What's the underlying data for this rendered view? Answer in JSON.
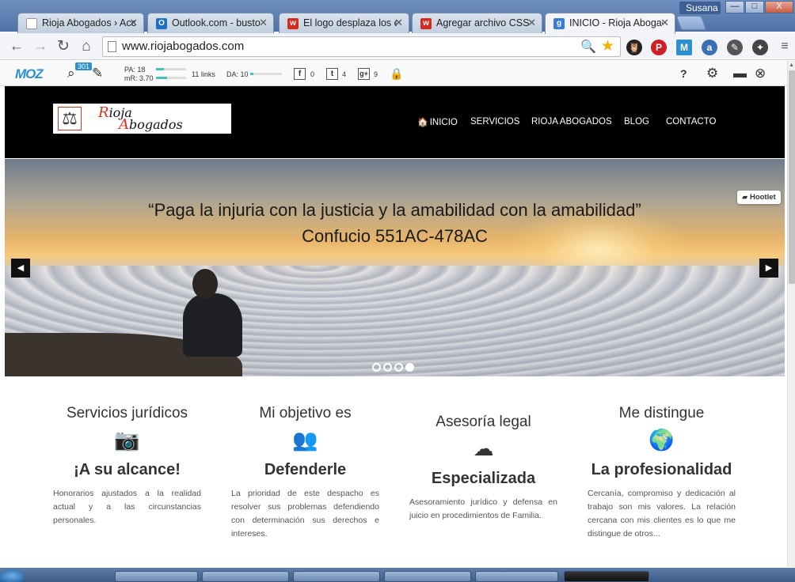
{
  "browser": {
    "tabs": [
      {
        "label": "Rioja Abogados › Acc",
        "favicon": "",
        "active": false
      },
      {
        "label": "Outlook.com - busto",
        "favicon": "O",
        "active": false
      },
      {
        "label": "El logo desplaza los el",
        "favicon": "w",
        "active": false
      },
      {
        "label": "Agregar archivo CSS |",
        "favicon": "w",
        "active": false
      },
      {
        "label": "INICIO - Rioja Abogad",
        "favicon": "g",
        "active": true
      }
    ],
    "profile": "Susana",
    "window_controls": {
      "minimize": "—",
      "maximize": "□",
      "close": "X"
    },
    "url": "www.riojabogados.com"
  },
  "mozbar": {
    "logo": "MOZ",
    "redirect_badge": "301",
    "pa": "PA: 18",
    "mr": "mR: 3.70",
    "links": "11 links",
    "da": "DA: 10",
    "facebook_count": "0",
    "twitter_count": "4",
    "gplus_count": "9",
    "help": "?"
  },
  "site": {
    "logo": {
      "line1_initial": "R",
      "line1_rest": "ioja",
      "line2_initial": "A",
      "line2_rest": "bogados"
    },
    "nav": [
      {
        "label": "INICIO"
      },
      {
        "label": "SERVICIOS"
      },
      {
        "label": "RIOJA ABOGADOS"
      },
      {
        "label": "BLOG"
      },
      {
        "label": "CONTACTO"
      }
    ],
    "hero": {
      "quote": "“Paga la injuria con la justicia y la amabilidad con la amabilidad”",
      "author": "Confucio 551AC-478AC",
      "prev": "◀",
      "next": "▶",
      "slide_count": 4,
      "active_slide": 4,
      "hootlet": "Hootlet"
    },
    "features": [
      {
        "title": "Servicios jurídicos",
        "icon": "camera-icon",
        "glyph": "📷",
        "subtitle": "¡A su alcance!",
        "text": "Honorarios ajustados a la realidad actual y a las circunstancias personales."
      },
      {
        "title": "Mi objetivo es",
        "icon": "users-icon",
        "glyph": "👥",
        "subtitle": "Defenderle",
        "text": "La prioridad de este despacho es resolver sus problemas defendiendo con determinación sus derechos e intereses."
      },
      {
        "title": "Asesoría legal",
        "icon": "cloud-icon",
        "glyph": "☁",
        "subtitle": "Especializada",
        "text": "Asesoramiento jurídico y defensa en juicio en procedimientos de Familia."
      },
      {
        "title": "Me distingue",
        "icon": "globe-icon",
        "glyph": "🌍",
        "subtitle": "La profesionalidad",
        "text": "Cercanía, compromiso y dedicación al trabajo son mis valores. La relación cercana con mis clientes es lo que me distingue de otros..."
      }
    ]
  },
  "colors": {
    "header_bg": "#000000",
    "moz_accent": "#2d8fce",
    "moz_bar": "#46c4bb"
  }
}
